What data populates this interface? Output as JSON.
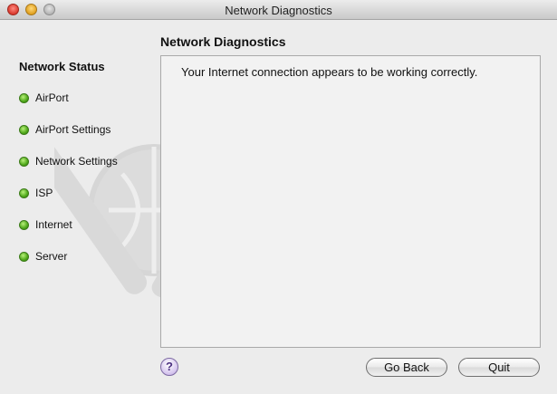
{
  "window": {
    "title": "Network Diagnostics"
  },
  "sidebar": {
    "heading": "Network Status",
    "items": [
      {
        "label": "AirPort",
        "status": "ok",
        "status_color": "#4fa81a"
      },
      {
        "label": "AirPort Settings",
        "status": "ok",
        "status_color": "#4fa81a"
      },
      {
        "label": "Network Settings",
        "status": "ok",
        "status_color": "#4fa81a"
      },
      {
        "label": "ISP",
        "status": "ok",
        "status_color": "#4fa81a"
      },
      {
        "label": "Internet",
        "status": "ok",
        "status_color": "#4fa81a"
      },
      {
        "label": "Server",
        "status": "ok",
        "status_color": "#4fa81a"
      }
    ]
  },
  "main": {
    "title": "Network Diagnostics",
    "message": "Your Internet connection appears to be working correctly."
  },
  "footer": {
    "help_label": "?",
    "back_label": "Go Back",
    "quit_label": "Quit"
  },
  "icons": {
    "close": "close-icon",
    "minimize": "minimize-icon",
    "zoom": "zoom-icon",
    "help": "help-icon",
    "status": "status-light-icon",
    "watermark": "network-tools-icon"
  }
}
